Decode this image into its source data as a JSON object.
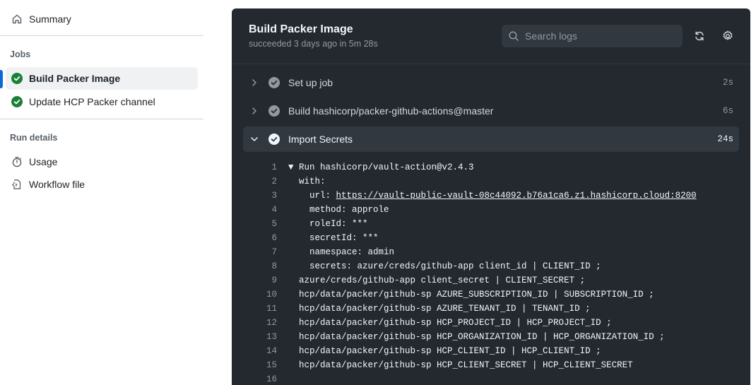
{
  "sidebar": {
    "summary_label": "Summary",
    "jobs_title": "Jobs",
    "jobs": [
      {
        "label": "Build Packer Image",
        "status": "success",
        "active": true
      },
      {
        "label": "Update HCP Packer channel",
        "status": "success",
        "active": false
      }
    ],
    "run_details_title": "Run details",
    "details": [
      {
        "label": "Usage",
        "icon": "stopwatch-icon"
      },
      {
        "label": "Workflow file",
        "icon": "workflow-file-icon"
      }
    ]
  },
  "job": {
    "title": "Build Packer Image",
    "subtitle": "succeeded 3 days ago in 5m 28s"
  },
  "search": {
    "placeholder": "Search logs"
  },
  "steps": [
    {
      "label": "Set up job",
      "duration": "2s",
      "expanded": false
    },
    {
      "label": "Build hashicorp/packer-github-actions@master",
      "duration": "6s",
      "expanded": false
    },
    {
      "label": "Import Secrets",
      "duration": "24s",
      "expanded": true
    }
  ],
  "log_lines": [
    {
      "n": "1",
      "text": "▼ Run hashicorp/vault-action@v2.4.3"
    },
    {
      "n": "2",
      "text": "  with:"
    },
    {
      "n": "3",
      "text": "    url: ",
      "link": "https://vault-public-vault-08c44092.b76a1ca6.z1.hashicorp.cloud:8200"
    },
    {
      "n": "4",
      "text": "    method: approle"
    },
    {
      "n": "5",
      "text": "    roleId: ***"
    },
    {
      "n": "6",
      "text": "    secretId: ***"
    },
    {
      "n": "7",
      "text": "    namespace: admin"
    },
    {
      "n": "8",
      "text": "    secrets: azure/creds/github-app client_id | CLIENT_ID ;"
    },
    {
      "n": "9",
      "text": "  azure/creds/github-app client_secret | CLIENT_SECRET ;"
    },
    {
      "n": "10",
      "text": "  hcp/data/packer/github-sp AZURE_SUBSCRIPTION_ID | SUBSCRIPTION_ID ;"
    },
    {
      "n": "11",
      "text": "  hcp/data/packer/github-sp AZURE_TENANT_ID | TENANT_ID ;"
    },
    {
      "n": "12",
      "text": "  hcp/data/packer/github-sp HCP_PROJECT_ID | HCP_PROJECT_ID ;"
    },
    {
      "n": "13",
      "text": "  hcp/data/packer/github-sp HCP_ORGANIZATION_ID | HCP_ORGANIZATION_ID ;"
    },
    {
      "n": "14",
      "text": "  hcp/data/packer/github-sp HCP_CLIENT_ID | HCP_CLIENT_ID ;"
    },
    {
      "n": "15",
      "text": "  hcp/data/packer/github-sp HCP_CLIENT_SECRET | HCP_CLIENT_SECRET"
    },
    {
      "n": "16",
      "text": ""
    }
  ],
  "colors": {
    "success": "#1a7f37",
    "accent": "#0969da",
    "panel_bg": "#24292f"
  }
}
